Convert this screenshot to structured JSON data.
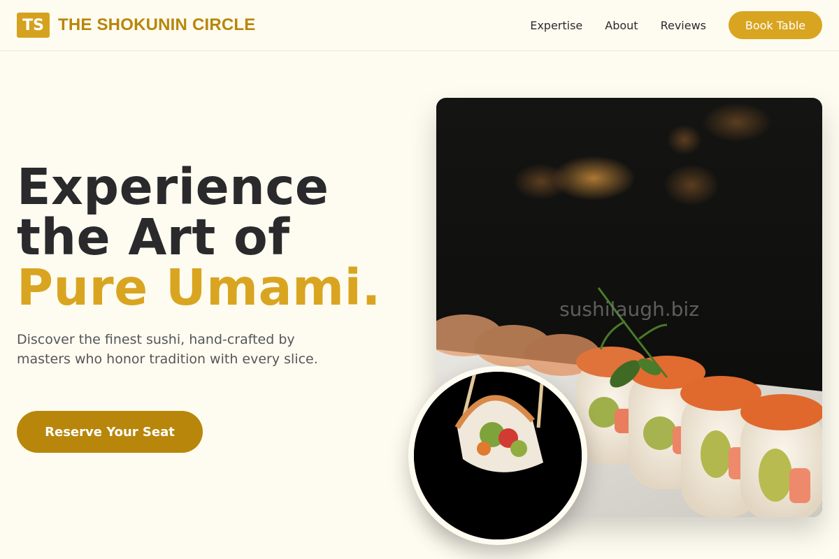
{
  "header": {
    "brand_mark": "TS",
    "brand_name": "THE SHOKUNIN CIRCLE",
    "nav": [
      "Expertise",
      "About",
      "Reviews"
    ],
    "book_button": "Book Table"
  },
  "hero": {
    "title_line1": "Experience",
    "title_line2": "the Art of",
    "title_accent": "Pure Umami.",
    "subtitle": "Discover the finest sushi, hand-crafted by masters who honor tradition with every slice.",
    "cta": "Reserve Your Seat",
    "image_watermark": "sushilaugh.biz"
  },
  "colors": {
    "background": "#fefcf0",
    "accent_gold": "#d9a521",
    "brand_dark_gold": "#b8860b",
    "text_dark": "#2a2a2d"
  }
}
